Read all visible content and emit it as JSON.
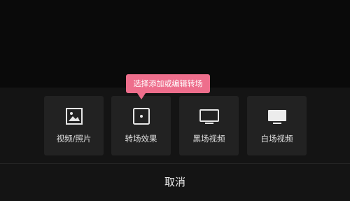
{
  "tooltip": {
    "text": "选择添加或编辑转场",
    "color": "#ee6e8c"
  },
  "options": [
    {
      "label": "视频/照片",
      "icon": "image-icon"
    },
    {
      "label": "转场效果",
      "icon": "transition-dot-icon"
    },
    {
      "label": "黑场视频",
      "icon": "monitor-outline-icon"
    },
    {
      "label": "白场视频",
      "icon": "monitor-filled-icon"
    }
  ],
  "cancel_label": "取消"
}
